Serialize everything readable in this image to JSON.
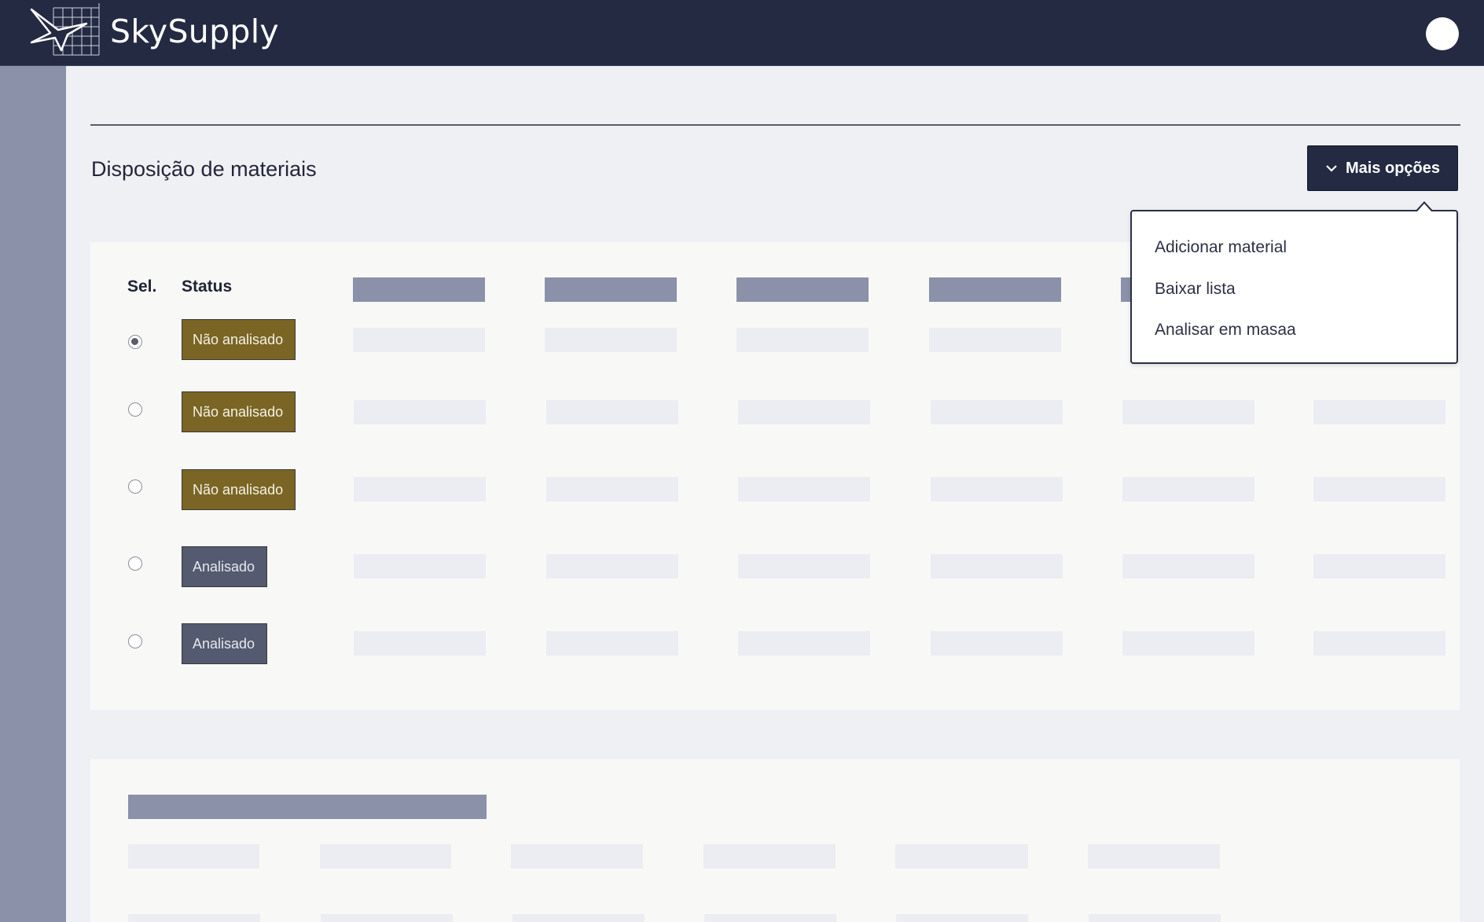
{
  "app": {
    "brand": "SkySupply",
    "logo_icon": "bird-grid-logo",
    "user_avatar": "avatar-circle"
  },
  "page": {
    "title": "Disposição de materiais",
    "more_options_label": "Mais opções",
    "more_options_icon": "chevron-down-icon"
  },
  "dropdown": {
    "items": [
      "Adicionar material",
      "Baixar lista",
      "Analisar em masaa"
    ]
  },
  "table": {
    "headers": {
      "select": "Sel.",
      "status": "Status"
    },
    "rows": [
      {
        "selected": true,
        "status": "Não analisado",
        "state": "pending"
      },
      {
        "selected": false,
        "status": "Não analisado",
        "state": "pending"
      },
      {
        "selected": false,
        "status": "Não analisado",
        "state": "pending"
      },
      {
        "selected": false,
        "status": "Analisado",
        "state": "done"
      },
      {
        "selected": false,
        "status": "Analisado",
        "state": "done"
      }
    ]
  },
  "colors": {
    "topbar": "#232a42",
    "sidebar": "#8a91a8",
    "pending_badge": "#7a6524",
    "done_badge": "#545a6f",
    "placeholder_header": "#8a91a8",
    "placeholder_cell": "#ebedf2"
  }
}
